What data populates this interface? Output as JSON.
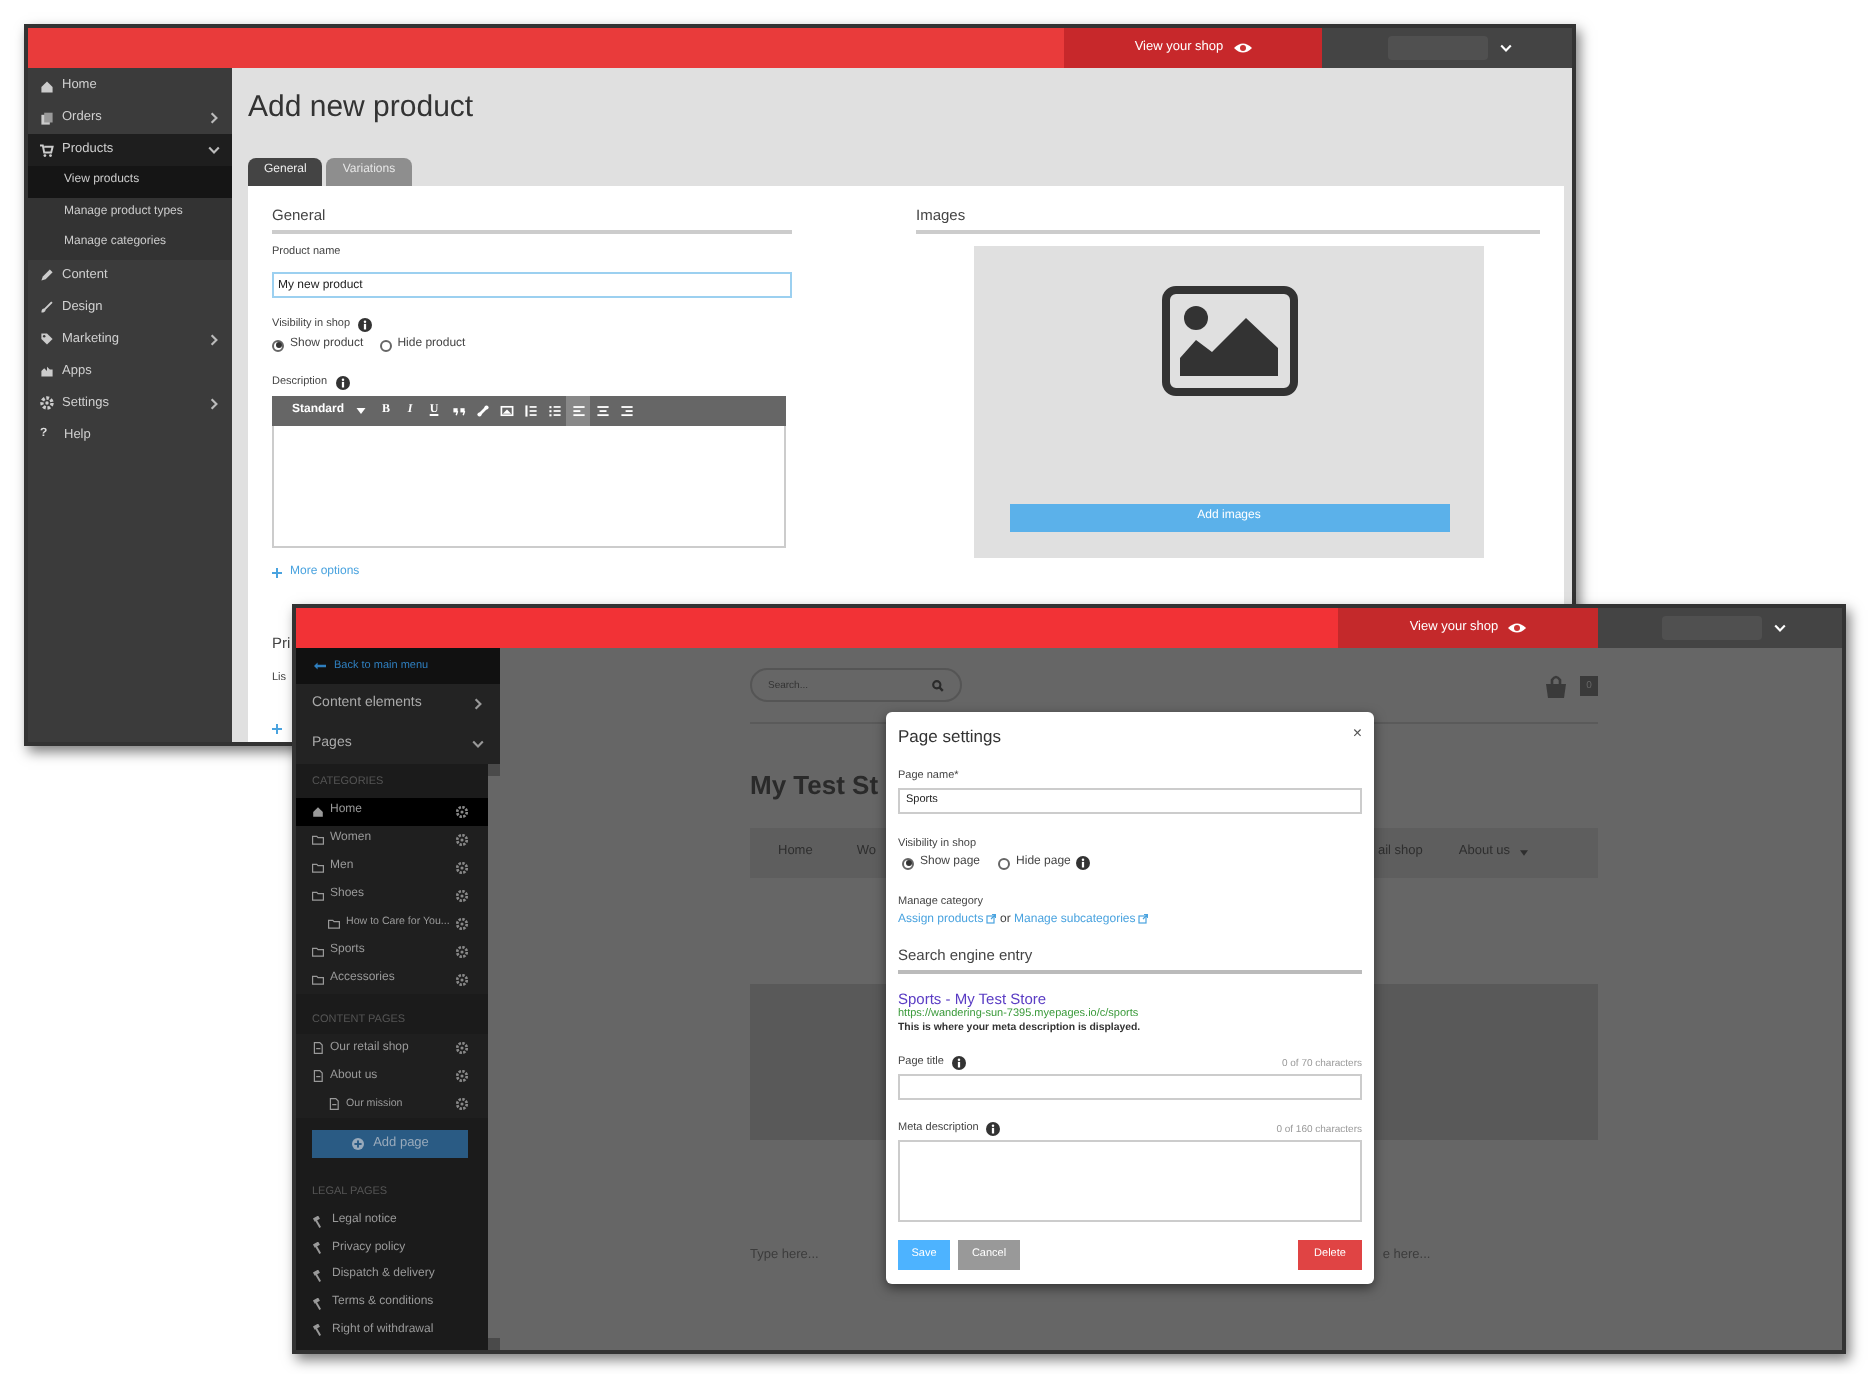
{
  "admin_window": {
    "top_bar": {
      "view_shop": "View your shop"
    },
    "sidebar": [
      {
        "label": "Home",
        "selected": false
      },
      {
        "label": "Orders",
        "selected": false,
        "expanded": false
      },
      {
        "label": "Products",
        "selected": true,
        "expanded": true,
        "children": [
          {
            "label": "View products",
            "selected": true
          },
          {
            "label": "Manage product types",
            "selected": false
          },
          {
            "label": "Manage categories",
            "selected": false
          }
        ]
      },
      {
        "label": "Content",
        "selected": false
      },
      {
        "label": "Design",
        "selected": false
      },
      {
        "label": "Marketing",
        "selected": false,
        "expanded": false
      },
      {
        "label": "Apps",
        "selected": false
      },
      {
        "label": "Settings",
        "selected": false,
        "expanded": false
      },
      {
        "label": "Help",
        "selected": false,
        "glyph": "?"
      }
    ],
    "title": "Add new product",
    "tabs": [
      {
        "label": "General",
        "selected": true
      },
      {
        "label": "Variations",
        "selected": false
      }
    ],
    "general": {
      "heading": "General",
      "product_name": {
        "label": "Product name",
        "value": "My new product"
      },
      "visibility": {
        "label": "Visibility in shop",
        "options": [
          {
            "label": "Show product",
            "selected": true
          },
          {
            "label": "Hide product",
            "selected": false
          }
        ]
      },
      "description": {
        "label": "Description",
        "format": "Standard",
        "text_buttons": [
          "B",
          "I",
          "U"
        ],
        "icon_buttons": [
          {
            "active": false
          },
          {
            "active": false
          },
          {
            "active": false
          },
          {
            "active": false
          },
          {
            "active": false
          },
          {
            "active": true
          },
          {
            "active": false
          },
          {
            "active": false
          }
        ]
      },
      "more_options": "More options"
    },
    "images": {
      "heading": "Images",
      "button": "Add images"
    },
    "price": {
      "heading": "Pri",
      "field_label": "Lis"
    }
  },
  "editor_window": {
    "top_bar": {
      "view_shop": "View your shop"
    },
    "sidebar": {
      "back": "Back to main menu",
      "sections": [
        {
          "label": "Content elements",
          "expanded": false
        },
        {
          "label": "Pages",
          "expanded": true
        }
      ],
      "groups": [
        {
          "heading": "CATEGORIES",
          "items": [
            {
              "label": "Home",
              "kind": "home",
              "selected": true
            },
            {
              "label": "Women",
              "kind": "folder",
              "selected": false
            },
            {
              "label": "Men",
              "kind": "folder",
              "selected": false
            },
            {
              "label": "Shoes",
              "kind": "folder",
              "selected": false,
              "children": [
                {
                  "label": "How to Care for You...",
                  "kind": "folder",
                  "selected": false
                }
              ]
            },
            {
              "label": "Sports",
              "kind": "folder",
              "selected": false
            },
            {
              "label": "Accessories",
              "kind": "folder",
              "selected": false
            }
          ]
        },
        {
          "heading": "CONTENT PAGES",
          "items": [
            {
              "label": "Our retail shop",
              "kind": "page",
              "selected": false
            },
            {
              "label": "About us",
              "kind": "page",
              "selected": false,
              "children": [
                {
                  "label": "Our mission",
                  "kind": "page",
                  "selected": false
                }
              ]
            }
          ]
        }
      ],
      "add_page": "Add page",
      "legal": {
        "heading": "LEGAL PAGES",
        "items": [
          "Legal notice",
          "Privacy policy",
          "Dispatch & delivery",
          "Terms & conditions",
          "Right of withdrawal"
        ]
      }
    },
    "page": {
      "search_placeholder": "Search...",
      "cart_count": "0",
      "heading": "My Test St",
      "nav": [
        {
          "label": "Home",
          "dropdown": false
        },
        {
          "label": "Wo",
          "dropdown": false
        },
        {
          "label": "ail shop",
          "dropdown": false
        },
        {
          "label": "About us",
          "dropdown": true
        }
      ],
      "type_here": [
        "Type here...",
        "e here..."
      ]
    },
    "modal": {
      "title": "Page settings",
      "close": "×",
      "page_name": {
        "label": "Page name*",
        "value": "Sports"
      },
      "visibility": {
        "label": "Visibility in shop",
        "options": [
          {
            "label": "Show page",
            "selected": true
          },
          {
            "label": "Hide page",
            "selected": false
          }
        ]
      },
      "manage_category": {
        "label": "Manage category",
        "links": [
          "Assign products",
          "Manage subcategories"
        ],
        "joiner": "or"
      },
      "seo_heading": "Search engine entry",
      "preview": {
        "title": "Sports - My Test Store",
        "url": "https://wandering-sun-7395.myepages.io/c/sports",
        "description": "This is where your meta description is displayed."
      },
      "page_title": {
        "label": "Page title",
        "counter": "0 of 70 characters"
      },
      "meta_description": {
        "label": "Meta description",
        "counter": "0 of 160 characters"
      },
      "buttons": {
        "save": "Save",
        "cancel": "Cancel",
        "delete": "Delete"
      }
    }
  }
}
